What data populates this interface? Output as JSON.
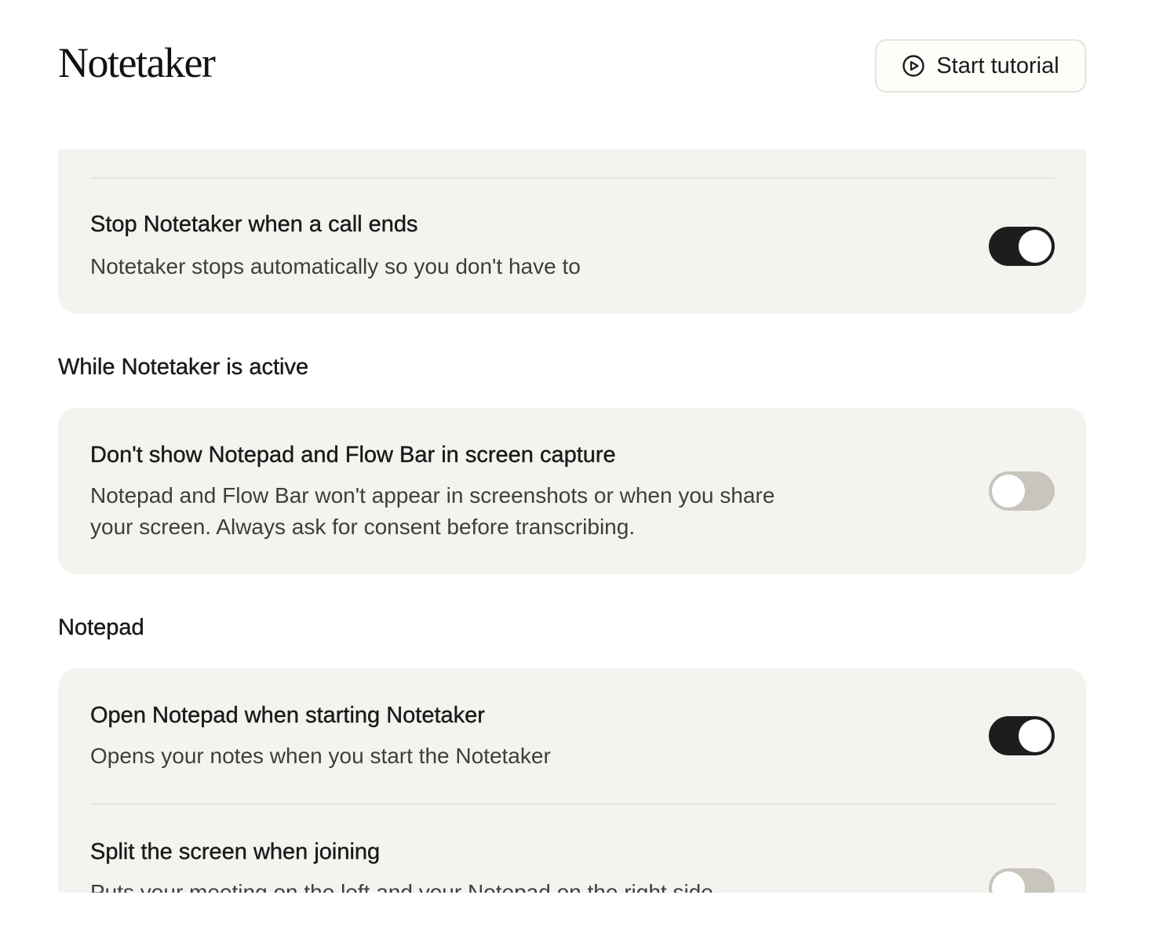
{
  "header": {
    "title": "Notetaker",
    "tutorial_button_label": "Start tutorial",
    "tutorial_icon": "play-circle-icon"
  },
  "colors": {
    "card_background": "#f4f3ef",
    "toggle_on": "#1d1d1d",
    "toggle_off": "#c8c5bd"
  },
  "sections": {
    "general": {
      "items": [
        {
          "title": "Stop Notetaker when a call ends",
          "description": "Notetaker stops automatically so you don't have to",
          "enabled": true
        }
      ]
    },
    "while_active": {
      "heading": "While Notetaker is active",
      "items": [
        {
          "title": "Don't show Notepad and Flow Bar in screen capture",
          "description": "Notepad and Flow Bar won't appear in screenshots or when you share your screen. Always ask for consent before transcribing.",
          "enabled": false
        }
      ]
    },
    "notepad": {
      "heading": "Notepad",
      "items": [
        {
          "title": "Open Notepad when starting Notetaker",
          "description": "Opens your notes when you start the Notetaker",
          "enabled": true
        },
        {
          "title": "Split the screen when joining",
          "description": "Puts your meeting on the left and your Notepad on the right side",
          "enabled": false
        }
      ]
    }
  }
}
